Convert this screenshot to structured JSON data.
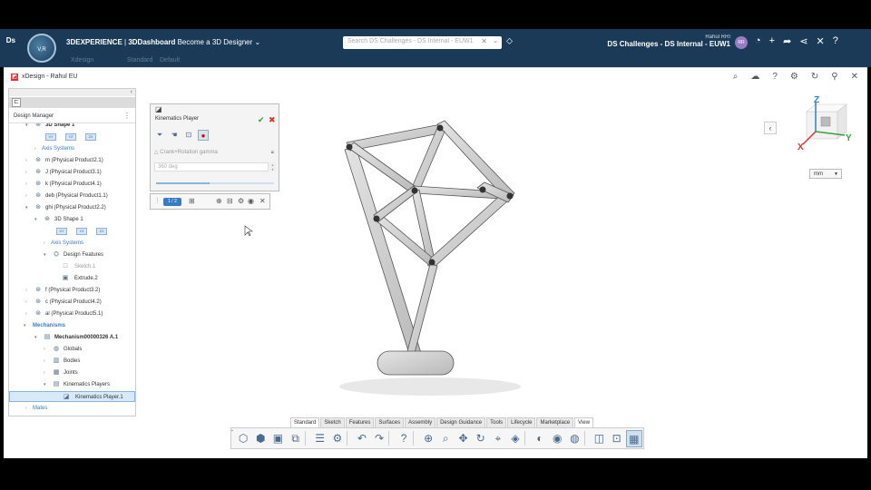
{
  "header": {
    "brand": "3DEXPERIENCE",
    "dashboard": "3DDashboard",
    "project": "Become a 3D Designer",
    "search_placeholder": "Search DS Challenges - DS Internal - EUW1",
    "user_name": "Rahul RRI",
    "tenant": "DS Challenges - DS Internal - EUW1",
    "avatar_initials": "RR",
    "compass_label": "V,R"
  },
  "subbar": {
    "items": [
      "Xdesign",
      "Standard",
      "Default"
    ]
  },
  "app": {
    "title": "xDesign - Rahul EU"
  },
  "tree": {
    "title": "Design Manager",
    "rows": [
      {
        "label": "3D Shape 1",
        "style": "bold"
      },
      {
        "label": "Axis Systems",
        "style": "blue"
      },
      {
        "label": "m (Physical Product2.1)",
        "style": ""
      },
      {
        "label": "J (Physical Product3.1)",
        "style": ""
      },
      {
        "label": "k (Physical Product4.1)",
        "style": ""
      },
      {
        "label": "deb (Physical Product1.1)",
        "style": ""
      },
      {
        "label": "ghi (Physical Product2.2)",
        "style": ""
      },
      {
        "label": "3D Shape 1",
        "style": ""
      },
      {
        "label": "Axis Systems",
        "style": "blue"
      },
      {
        "label": "Design Features",
        "style": ""
      },
      {
        "label": "Sketch.1",
        "style": "grey"
      },
      {
        "label": "Extrude.2",
        "style": ""
      },
      {
        "label": "f (Physical Product3.2)",
        "style": ""
      },
      {
        "label": "c (Physical Product4.2)",
        "style": ""
      },
      {
        "label": "al (Physical Product5.1)",
        "style": ""
      },
      {
        "label": "Mechanisms",
        "style": "blue-bold"
      },
      {
        "label": "Mechanism00000326 A.1",
        "style": "bold"
      },
      {
        "label": "Globals",
        "style": ""
      },
      {
        "label": "Bodies",
        "style": ""
      },
      {
        "label": "Joints",
        "style": ""
      },
      {
        "label": "Kinematics Players",
        "style": ""
      },
      {
        "label": "Kinematics Player.1",
        "style": ""
      },
      {
        "label": "Mates",
        "style": "blue"
      }
    ],
    "planes": [
      "XY",
      "YZ",
      "ZX"
    ]
  },
  "kinematics_player": {
    "title": "Kinematics Player",
    "command": "Crank+Rotation gamma",
    "angle_value": "360 deg",
    "progress": 0.45
  },
  "playback": {
    "counter": "1 / 2"
  },
  "triad": {
    "x": "X",
    "y": "Y",
    "z": "Z"
  },
  "units": {
    "selected": "mm"
  },
  "tabs": [
    {
      "label": "Standard",
      "active": true
    },
    {
      "label": "Sketch",
      "active": false
    },
    {
      "label": "Features",
      "active": false
    },
    {
      "label": "Surfaces",
      "active": false
    },
    {
      "label": "Assembly",
      "active": false
    },
    {
      "label": "Design Guidance",
      "active": false
    },
    {
      "label": "Tools",
      "active": false
    },
    {
      "label": "Lifecycle",
      "active": false
    },
    {
      "label": "Marketplace",
      "active": false
    },
    {
      "label": "View",
      "active": true
    }
  ],
  "toolbar_icons": [
    "new-part-icon",
    "open-icon",
    "save-icon",
    "save-as-icon",
    "separator",
    "properties-icon",
    "settings-icon",
    "separator",
    "undo-icon",
    "redo-icon",
    "separator",
    "help-icon",
    "separator",
    "lock-view-icon",
    "zoom-icon",
    "pan-icon",
    "rotate-icon",
    "zoom-area-icon",
    "view-cube-icon",
    "separator",
    "hide-show-icon",
    "render-icon",
    "material-icon",
    "separator",
    "section-icon",
    "measure-icon",
    "display-icon"
  ],
  "colors": {
    "topbar": "#1b3a57",
    "accent": "#3a7cc4",
    "link_green": "#2a9d2a",
    "cancel_red": "#d32f2f",
    "triad_x": "#d33333",
    "triad_y": "#3aa13a",
    "triad_z": "#2f7fc4"
  }
}
